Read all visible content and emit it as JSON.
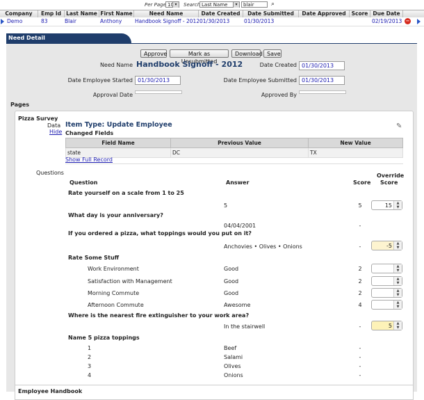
{
  "toolbar": {
    "per_page_label": "Per Page",
    "per_page_value": "10",
    "search_label": "Search",
    "search_field": "Last Name",
    "search_value": "blair"
  },
  "grid": {
    "columns": [
      "Company",
      "Emp Id",
      "Last Name",
      "First Name",
      "Need Name",
      "Date Created",
      "Date Submitted",
      "Date Approved",
      "Score",
      "Due Date"
    ],
    "row": {
      "company": "Demo",
      "emp_id": "83",
      "last_name": "Blair",
      "first_name": "Anthony",
      "need_name": "Handbook Signoff - 2012",
      "date_created": "01/30/2013",
      "date_submitted": "01/30/2013",
      "date_approved": "",
      "score": "",
      "due_date": "02/19/2013"
    }
  },
  "panel": {
    "title": "Need Detail",
    "buttons": {
      "approve": "Approve",
      "unsubmit": "Mark as Unsubmitted",
      "download": "Download",
      "save": "Save"
    },
    "need_name_label": "Need Name",
    "need_name": "Handbook Signoff - 2012",
    "date_created_label": "Date Created",
    "date_created": "01/30/2013",
    "date_started_label": "Date Employee Started",
    "date_started": "01/30/2013",
    "date_submitted_label": "Date Employee Submitted",
    "date_submitted": "01/30/2013",
    "approval_date_label": "Approval Date",
    "approved_by_label": "Approved By",
    "pages_label": "Pages"
  },
  "survey": {
    "title": "Pizza Survey",
    "data_label": "Data",
    "hide_link": "Hide",
    "item_type": "Item Type: Update  Employee",
    "changed_fields_label": "Changed Fields",
    "cf_headers": [
      "Field Name",
      "Previous Value",
      "New Value"
    ],
    "cf_row": [
      "state",
      "DC",
      "TX"
    ],
    "show_full_record": "Show Full Record",
    "questions_label": "Questions",
    "col_question": "Question",
    "col_answer": "Answer",
    "col_score": "Score",
    "col_override": "Override",
    "col_override2": "Score",
    "q1": "Rate yourself on a scale from 1 to 25",
    "q1_answer": "5",
    "q1_score": "5",
    "q1_override": "15",
    "q2": "What day is your anniversary?",
    "q2_answer": "04/04/2001",
    "q3": "If you ordered a pizza, what toppings would you put on it?",
    "q3_answer": "Anchovies • Olives • Onions",
    "q3_score": "-",
    "q3_override": "-5",
    "q4": "Rate Some Stuff",
    "q4_items": [
      {
        "label": "Work Environment",
        "answer": "Good",
        "score": "2"
      },
      {
        "label": "Satisfaction with Management",
        "answer": "Good",
        "score": "2"
      },
      {
        "label": "Morning Commute",
        "answer": "Good",
        "score": "2"
      },
      {
        "label": "Afternoon Commute",
        "answer": "Awesome",
        "score": "4"
      }
    ],
    "q5": "Where is the nearest fire extinguisher to your work area?",
    "q5_answer": "In the stairwell",
    "q5_score": "-",
    "q5_override": "5",
    "q6": "Name 5 pizza toppings",
    "q6_items": [
      {
        "label": "1",
        "answer": "Beef",
        "score": "-"
      },
      {
        "label": "2",
        "answer": "Salami",
        "score": "-"
      },
      {
        "label": "3",
        "answer": "Olives",
        "score": "-"
      },
      {
        "label": "4",
        "answer": "Onions",
        "score": "-"
      }
    ],
    "q2_score": "-"
  },
  "next_section": "Employee Handbook"
}
